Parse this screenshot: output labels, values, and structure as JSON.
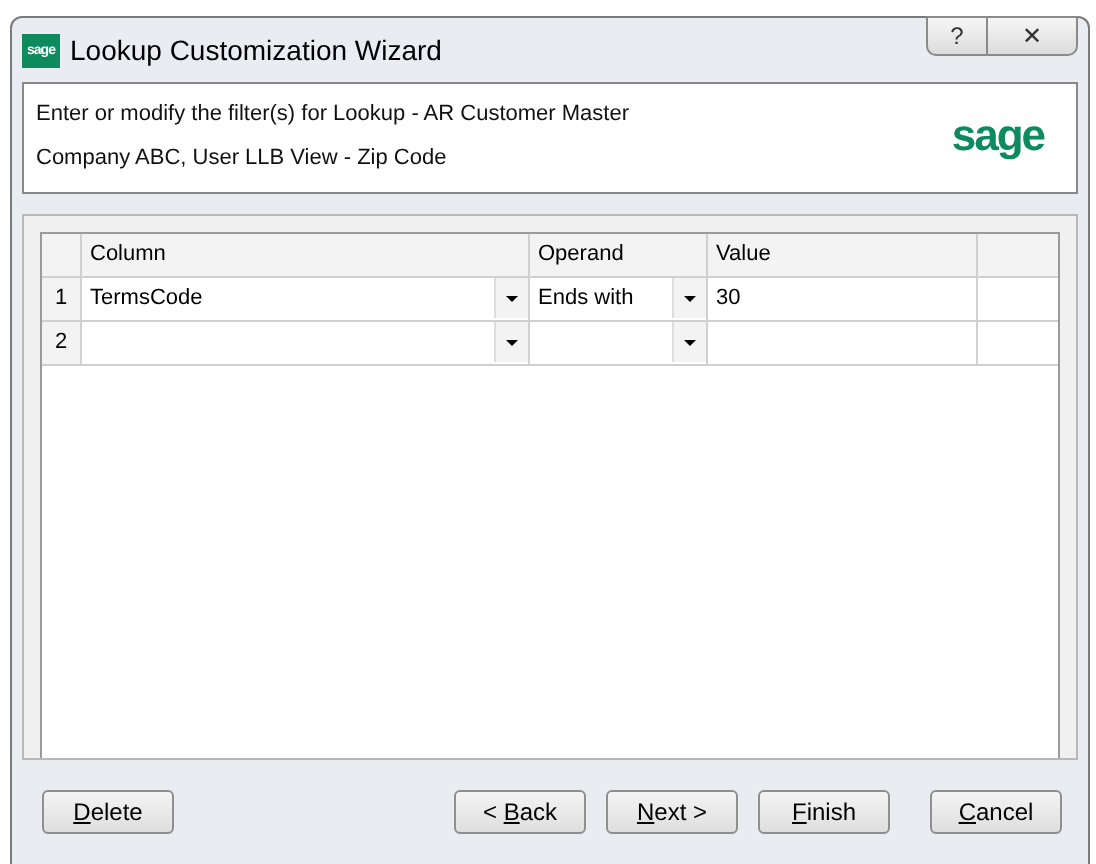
{
  "window": {
    "title": "Lookup Customization Wizard",
    "icon_text": "sage",
    "help": "?",
    "close": "✕"
  },
  "header": {
    "lines": [
      "Enter or modify the filter(s) for Lookup - AR Customer Master",
      "Company ABC, User LLB View - Zip Code"
    ],
    "logo": "sage"
  },
  "table": {
    "columns": [
      "Column",
      "Operand",
      "Value"
    ],
    "rows": [
      {
        "number": "1",
        "column": "TermsCode",
        "operand": "Ends with",
        "value": "30"
      },
      {
        "number": "2"
      }
    ]
  },
  "buttons": [
    {
      "key": "D",
      "after": "elete"
    },
    {
      "before": "< ",
      "key": "B",
      "after": "ack"
    },
    {
      "key": "N",
      "after": "ext >"
    },
    {
      "key": "F",
      "after": "inish"
    },
    {
      "key": "C",
      "after": "ancel"
    }
  ]
}
